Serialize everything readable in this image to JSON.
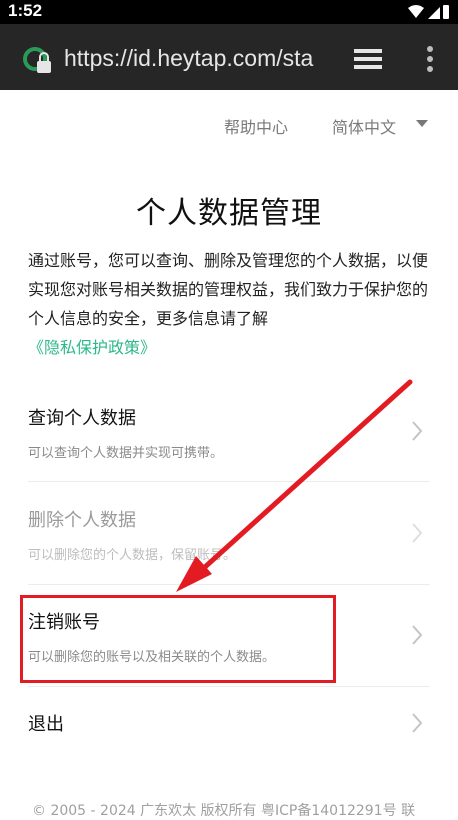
{
  "status_bar": {
    "time": "1:52"
  },
  "browser": {
    "url": "https://id.heytap.com/sta"
  },
  "topnav": {
    "help": "帮助中心",
    "language": "简体中文"
  },
  "page": {
    "title": "个人数据管理",
    "intro_text": "通过账号，您可以查询、删除及管理您的个人数据，以便实现您对账号相关数据的管理权益，我们致力于保护您的个人信息的安全，更多信息请了解",
    "policy_link": "《隐私保护政策》"
  },
  "menu": [
    {
      "label": "查询个人数据",
      "desc": "可以查询个人数据并实现可携带。",
      "disabled": false
    },
    {
      "label": "删除个人数据",
      "desc": "可以删除您的个人数据，保留账号。",
      "disabled": true
    },
    {
      "label": "注销账号",
      "desc": "可以删除您的账号以及相关联的个人数据。",
      "disabled": false
    },
    {
      "label": "退出",
      "desc": "",
      "disabled": false
    }
  ],
  "footer": "© 2005 - 2024 广东欢太 版权所有 粤ICP备14012291号 联",
  "colors": {
    "accent_green": "#2db88a",
    "annotation_red": "#e31b23",
    "toolbar_bg": "#262626"
  }
}
